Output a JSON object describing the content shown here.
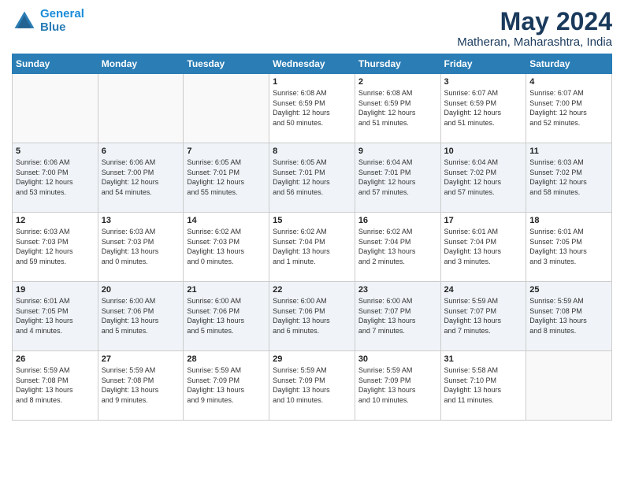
{
  "header": {
    "logo_line1": "General",
    "logo_line2": "Blue",
    "month_year": "May 2024",
    "location": "Matheran, Maharashtra, India"
  },
  "weekdays": [
    "Sunday",
    "Monday",
    "Tuesday",
    "Wednesday",
    "Thursday",
    "Friday",
    "Saturday"
  ],
  "weeks": [
    [
      {
        "day": "",
        "info": ""
      },
      {
        "day": "",
        "info": ""
      },
      {
        "day": "",
        "info": ""
      },
      {
        "day": "1",
        "info": "Sunrise: 6:08 AM\nSunset: 6:59 PM\nDaylight: 12 hours\nand 50 minutes."
      },
      {
        "day": "2",
        "info": "Sunrise: 6:08 AM\nSunset: 6:59 PM\nDaylight: 12 hours\nand 51 minutes."
      },
      {
        "day": "3",
        "info": "Sunrise: 6:07 AM\nSunset: 6:59 PM\nDaylight: 12 hours\nand 51 minutes."
      },
      {
        "day": "4",
        "info": "Sunrise: 6:07 AM\nSunset: 7:00 PM\nDaylight: 12 hours\nand 52 minutes."
      }
    ],
    [
      {
        "day": "5",
        "info": "Sunrise: 6:06 AM\nSunset: 7:00 PM\nDaylight: 12 hours\nand 53 minutes."
      },
      {
        "day": "6",
        "info": "Sunrise: 6:06 AM\nSunset: 7:00 PM\nDaylight: 12 hours\nand 54 minutes."
      },
      {
        "day": "7",
        "info": "Sunrise: 6:05 AM\nSunset: 7:01 PM\nDaylight: 12 hours\nand 55 minutes."
      },
      {
        "day": "8",
        "info": "Sunrise: 6:05 AM\nSunset: 7:01 PM\nDaylight: 12 hours\nand 56 minutes."
      },
      {
        "day": "9",
        "info": "Sunrise: 6:04 AM\nSunset: 7:01 PM\nDaylight: 12 hours\nand 57 minutes."
      },
      {
        "day": "10",
        "info": "Sunrise: 6:04 AM\nSunset: 7:02 PM\nDaylight: 12 hours\nand 57 minutes."
      },
      {
        "day": "11",
        "info": "Sunrise: 6:03 AM\nSunset: 7:02 PM\nDaylight: 12 hours\nand 58 minutes."
      }
    ],
    [
      {
        "day": "12",
        "info": "Sunrise: 6:03 AM\nSunset: 7:03 PM\nDaylight: 12 hours\nand 59 minutes."
      },
      {
        "day": "13",
        "info": "Sunrise: 6:03 AM\nSunset: 7:03 PM\nDaylight: 13 hours\nand 0 minutes."
      },
      {
        "day": "14",
        "info": "Sunrise: 6:02 AM\nSunset: 7:03 PM\nDaylight: 13 hours\nand 0 minutes."
      },
      {
        "day": "15",
        "info": "Sunrise: 6:02 AM\nSunset: 7:04 PM\nDaylight: 13 hours\nand 1 minute."
      },
      {
        "day": "16",
        "info": "Sunrise: 6:02 AM\nSunset: 7:04 PM\nDaylight: 13 hours\nand 2 minutes."
      },
      {
        "day": "17",
        "info": "Sunrise: 6:01 AM\nSunset: 7:04 PM\nDaylight: 13 hours\nand 3 minutes."
      },
      {
        "day": "18",
        "info": "Sunrise: 6:01 AM\nSunset: 7:05 PM\nDaylight: 13 hours\nand 3 minutes."
      }
    ],
    [
      {
        "day": "19",
        "info": "Sunrise: 6:01 AM\nSunset: 7:05 PM\nDaylight: 13 hours\nand 4 minutes."
      },
      {
        "day": "20",
        "info": "Sunrise: 6:00 AM\nSunset: 7:06 PM\nDaylight: 13 hours\nand 5 minutes."
      },
      {
        "day": "21",
        "info": "Sunrise: 6:00 AM\nSunset: 7:06 PM\nDaylight: 13 hours\nand 5 minutes."
      },
      {
        "day": "22",
        "info": "Sunrise: 6:00 AM\nSunset: 7:06 PM\nDaylight: 13 hours\nand 6 minutes."
      },
      {
        "day": "23",
        "info": "Sunrise: 6:00 AM\nSunset: 7:07 PM\nDaylight: 13 hours\nand 7 minutes."
      },
      {
        "day": "24",
        "info": "Sunrise: 5:59 AM\nSunset: 7:07 PM\nDaylight: 13 hours\nand 7 minutes."
      },
      {
        "day": "25",
        "info": "Sunrise: 5:59 AM\nSunset: 7:08 PM\nDaylight: 13 hours\nand 8 minutes."
      }
    ],
    [
      {
        "day": "26",
        "info": "Sunrise: 5:59 AM\nSunset: 7:08 PM\nDaylight: 13 hours\nand 8 minutes."
      },
      {
        "day": "27",
        "info": "Sunrise: 5:59 AM\nSunset: 7:08 PM\nDaylight: 13 hours\nand 9 minutes."
      },
      {
        "day": "28",
        "info": "Sunrise: 5:59 AM\nSunset: 7:09 PM\nDaylight: 13 hours\nand 9 minutes."
      },
      {
        "day": "29",
        "info": "Sunrise: 5:59 AM\nSunset: 7:09 PM\nDaylight: 13 hours\nand 10 minutes."
      },
      {
        "day": "30",
        "info": "Sunrise: 5:59 AM\nSunset: 7:09 PM\nDaylight: 13 hours\nand 10 minutes."
      },
      {
        "day": "31",
        "info": "Sunrise: 5:58 AM\nSunset: 7:10 PM\nDaylight: 13 hours\nand 11 minutes."
      },
      {
        "day": "",
        "info": ""
      }
    ]
  ]
}
